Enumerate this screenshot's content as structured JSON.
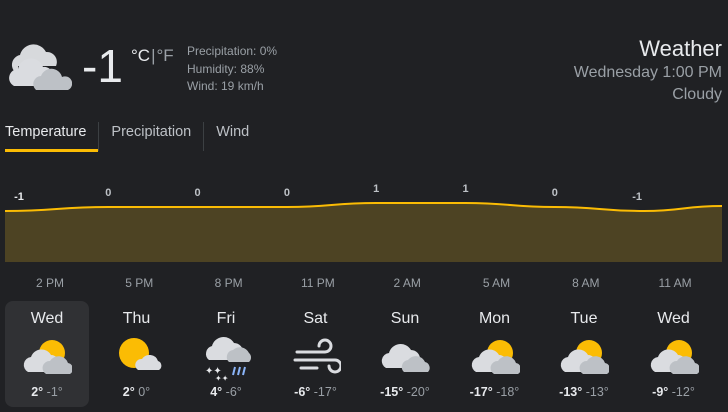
{
  "current": {
    "icon": "partly-cloudy-icon",
    "temp": "-1",
    "unit_c": "°C",
    "unit_sep": "|",
    "unit_f": "°F",
    "precipitation": "Precipitation: 0%",
    "humidity": "Humidity: 88%",
    "wind": "Wind: 19 km/h"
  },
  "header": {
    "title": "Weather",
    "datetime": "Wednesday 1:00 PM",
    "condition": "Cloudy"
  },
  "tabs": [
    {
      "label": "Temperature",
      "active": true
    },
    {
      "label": "Precipitation",
      "active": false
    },
    {
      "label": "Wind",
      "active": false
    }
  ],
  "chart_data": {
    "type": "area",
    "series": [
      {
        "values": [
          -1,
          0,
          0,
          0,
          1,
          1,
          0,
          -1
        ]
      }
    ],
    "x": [
      "2 PM",
      "5 PM",
      "8 PM",
      "11 PM",
      "2 AM",
      "5 AM",
      "8 AM",
      "11 AM"
    ],
    "colors": {
      "line": "#fbbc04",
      "fill": "#4d4323"
    }
  },
  "days": [
    {
      "name": "Wed",
      "icon": "sun-behind-cloud-icon",
      "hi": "2°",
      "lo": "-1°",
      "selected": true
    },
    {
      "name": "Thu",
      "icon": "sun-small-cloud-icon",
      "hi": "2°",
      "lo": "0°",
      "selected": false
    },
    {
      "name": "Fri",
      "icon": "snow-rain-cloud-icon",
      "hi": "4°",
      "lo": "-6°",
      "selected": false
    },
    {
      "name": "Sat",
      "icon": "wind-icon",
      "hi": "-6°",
      "lo": "-17°",
      "selected": false
    },
    {
      "name": "Sun",
      "icon": "cloud-icon",
      "hi": "-15°",
      "lo": "-20°",
      "selected": false
    },
    {
      "name": "Mon",
      "icon": "sun-behind-cloud-icon",
      "hi": "-17°",
      "lo": "-18°",
      "selected": false
    },
    {
      "name": "Tue",
      "icon": "sun-behind-cloud-icon",
      "hi": "-13°",
      "lo": "-13°",
      "selected": false
    },
    {
      "name": "Wed",
      "icon": "sun-behind-cloud-icon",
      "hi": "-9°",
      "lo": "-12°",
      "selected": false
    }
  ]
}
